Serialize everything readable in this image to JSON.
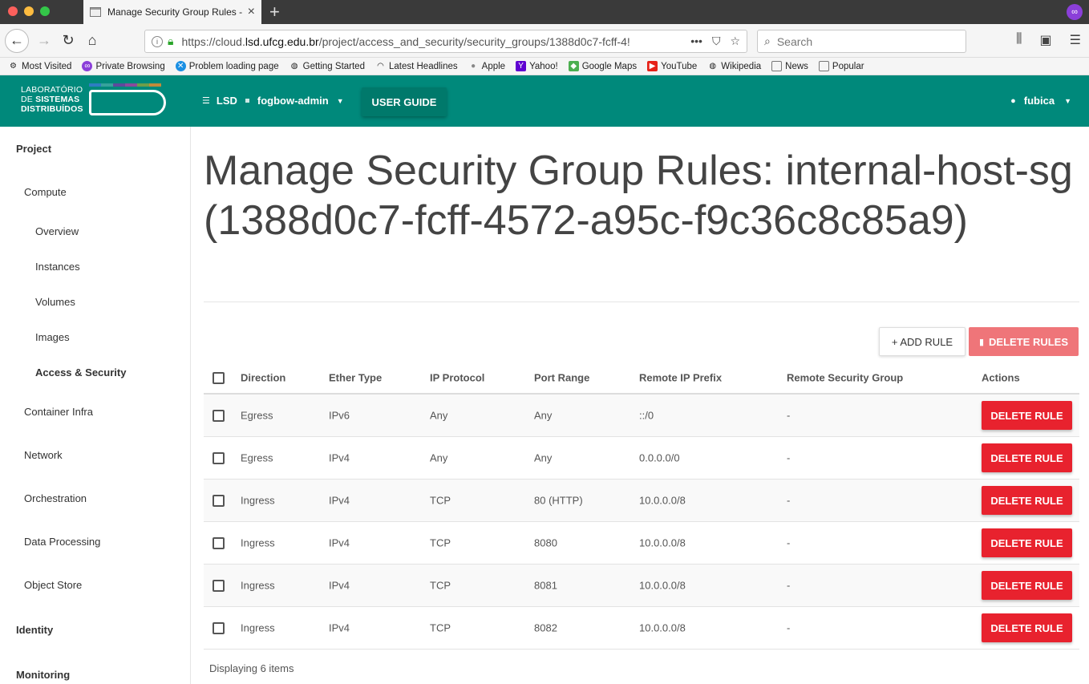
{
  "browser": {
    "tab_title": "Manage Security Group Rules - ",
    "url_prefix": "https://cloud.",
    "url_host": "lsd.ufcg.edu.br",
    "url_path": "/project/access_and_security/security_groups/1388d0c7-fcff-4!",
    "search_placeholder": "Search",
    "bookmarks": [
      "Most Visited",
      "Private Browsing",
      "Problem loading page",
      "Getting Started",
      "Latest Headlines",
      "Apple",
      "Yahoo!",
      "Google Maps",
      "YouTube",
      "Wikipedia",
      "News",
      "Popular"
    ]
  },
  "header": {
    "logo_line1": "LABORATÓRIO",
    "logo_line2_a": "DE ",
    "logo_line2_b": "SISTEMAS",
    "logo_line3": "DISTRIBUÍDOS",
    "domain": "LSD",
    "project": "fogbow-admin",
    "user_guide": "USER GUIDE",
    "user": "fubica"
  },
  "sidebar": {
    "project": "Project",
    "compute": "Compute",
    "overview": "Overview",
    "instances": "Instances",
    "volumes": "Volumes",
    "images": "Images",
    "access_security": "Access & Security",
    "container_infra": "Container Infra",
    "network": "Network",
    "orchestration": "Orchestration",
    "data_processing": "Data Processing",
    "object_store": "Object Store",
    "identity": "Identity",
    "monitoring": "Monitoring"
  },
  "page": {
    "title": "Manage Security Group Rules: internal-host-sg (1388d0c7-fcff-4572-a95c-f9c36c8c85a9)",
    "add_rule": "+ ADD RULE",
    "delete_rules": "DELETE RULES",
    "footer": "Displaying 6 items"
  },
  "table": {
    "headers": {
      "direction": "Direction",
      "ether_type": "Ether Type",
      "ip_protocol": "IP Protocol",
      "port_range": "Port Range",
      "remote_ip": "Remote IP Prefix",
      "remote_sg": "Remote Security Group",
      "actions": "Actions"
    },
    "delete_label": "DELETE RULE",
    "rows": [
      {
        "direction": "Egress",
        "ether": "IPv6",
        "proto": "Any",
        "port": "Any",
        "rip": "::/0",
        "rsg": "-"
      },
      {
        "direction": "Egress",
        "ether": "IPv4",
        "proto": "Any",
        "port": "Any",
        "rip": "0.0.0.0/0",
        "rsg": "-"
      },
      {
        "direction": "Ingress",
        "ether": "IPv4",
        "proto": "TCP",
        "port": "80 (HTTP)",
        "rip": "10.0.0.0/8",
        "rsg": "-"
      },
      {
        "direction": "Ingress",
        "ether": "IPv4",
        "proto": "TCP",
        "port": "8080",
        "rip": "10.0.0.0/8",
        "rsg": "-"
      },
      {
        "direction": "Ingress",
        "ether": "IPv4",
        "proto": "TCP",
        "port": "8081",
        "rip": "10.0.0.0/8",
        "rsg": "-"
      },
      {
        "direction": "Ingress",
        "ether": "IPv4",
        "proto": "TCP",
        "port": "8082",
        "rip": "10.0.0.0/8",
        "rsg": "-"
      }
    ]
  },
  "colors": {
    "brand": "#00897b",
    "danger": "#e8222e",
    "danger_light": "#ef7579"
  }
}
